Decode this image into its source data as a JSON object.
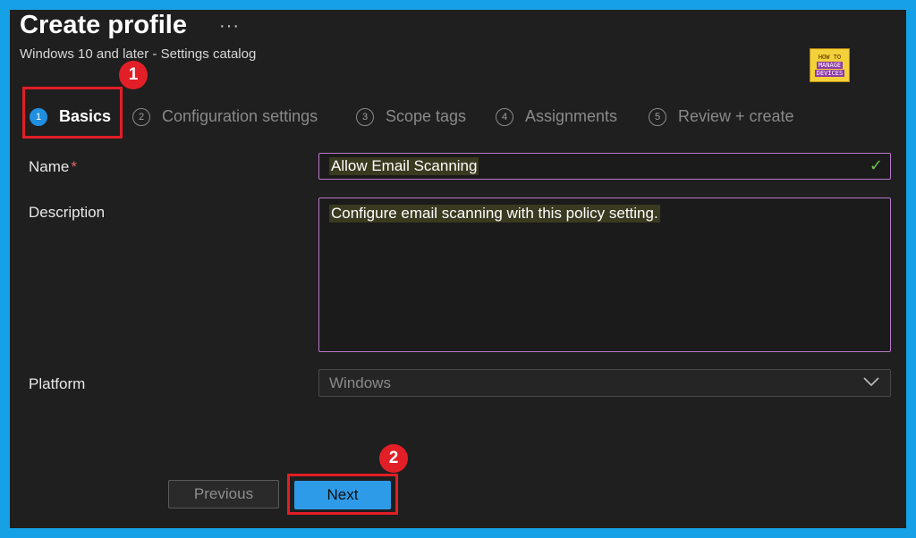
{
  "header": {
    "title": "Create profile",
    "more_label": "···",
    "subtitle": "Windows 10 and later - Settings catalog",
    "logo": {
      "line1": "HOW TO",
      "line2": "MANAGE",
      "line3": "DEVICES"
    }
  },
  "tabs": [
    {
      "num": "1",
      "label": "Basics",
      "active": true
    },
    {
      "num": "2",
      "label": "Configuration settings",
      "active": false
    },
    {
      "num": "3",
      "label": "Scope tags",
      "active": false
    },
    {
      "num": "4",
      "label": "Assignments",
      "active": false
    },
    {
      "num": "5",
      "label": "Review + create",
      "active": false
    }
  ],
  "form": {
    "name_label": "Name",
    "required_mark": "*",
    "name_value": "Allow Email Scanning",
    "description_label": "Description",
    "description_value": "Configure email scanning with this policy setting.",
    "platform_label": "Platform",
    "platform_value": "Windows"
  },
  "buttons": {
    "previous": "Previous",
    "next": "Next"
  },
  "annotations": {
    "badge1": "1",
    "badge2": "2"
  },
  "colors": {
    "accent": "#16a1e6",
    "highlight_red": "#e21e26",
    "primary_button": "#2e9be8",
    "field_border": "#b779c9"
  }
}
